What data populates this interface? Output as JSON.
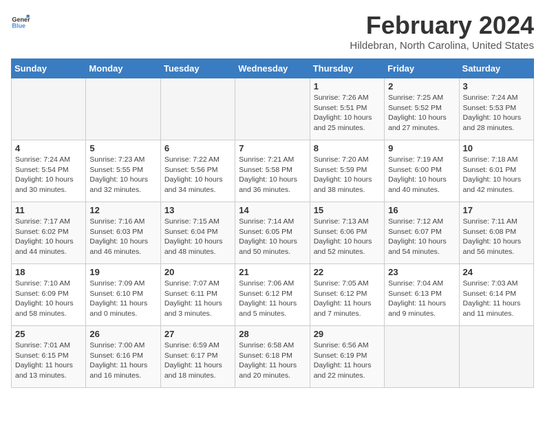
{
  "header": {
    "logo_general": "General",
    "logo_blue": "Blue",
    "title": "February 2024",
    "location": "Hildebran, North Carolina, United States"
  },
  "days_of_week": [
    "Sunday",
    "Monday",
    "Tuesday",
    "Wednesday",
    "Thursday",
    "Friday",
    "Saturday"
  ],
  "weeks": [
    [
      {
        "day": "",
        "info": ""
      },
      {
        "day": "",
        "info": ""
      },
      {
        "day": "",
        "info": ""
      },
      {
        "day": "",
        "info": ""
      },
      {
        "day": "1",
        "info": "Sunrise: 7:26 AM\nSunset: 5:51 PM\nDaylight: 10 hours\nand 25 minutes."
      },
      {
        "day": "2",
        "info": "Sunrise: 7:25 AM\nSunset: 5:52 PM\nDaylight: 10 hours\nand 27 minutes."
      },
      {
        "day": "3",
        "info": "Sunrise: 7:24 AM\nSunset: 5:53 PM\nDaylight: 10 hours\nand 28 minutes."
      }
    ],
    [
      {
        "day": "4",
        "info": "Sunrise: 7:24 AM\nSunset: 5:54 PM\nDaylight: 10 hours\nand 30 minutes."
      },
      {
        "day": "5",
        "info": "Sunrise: 7:23 AM\nSunset: 5:55 PM\nDaylight: 10 hours\nand 32 minutes."
      },
      {
        "day": "6",
        "info": "Sunrise: 7:22 AM\nSunset: 5:56 PM\nDaylight: 10 hours\nand 34 minutes."
      },
      {
        "day": "7",
        "info": "Sunrise: 7:21 AM\nSunset: 5:58 PM\nDaylight: 10 hours\nand 36 minutes."
      },
      {
        "day": "8",
        "info": "Sunrise: 7:20 AM\nSunset: 5:59 PM\nDaylight: 10 hours\nand 38 minutes."
      },
      {
        "day": "9",
        "info": "Sunrise: 7:19 AM\nSunset: 6:00 PM\nDaylight: 10 hours\nand 40 minutes."
      },
      {
        "day": "10",
        "info": "Sunrise: 7:18 AM\nSunset: 6:01 PM\nDaylight: 10 hours\nand 42 minutes."
      }
    ],
    [
      {
        "day": "11",
        "info": "Sunrise: 7:17 AM\nSunset: 6:02 PM\nDaylight: 10 hours\nand 44 minutes."
      },
      {
        "day": "12",
        "info": "Sunrise: 7:16 AM\nSunset: 6:03 PM\nDaylight: 10 hours\nand 46 minutes."
      },
      {
        "day": "13",
        "info": "Sunrise: 7:15 AM\nSunset: 6:04 PM\nDaylight: 10 hours\nand 48 minutes."
      },
      {
        "day": "14",
        "info": "Sunrise: 7:14 AM\nSunset: 6:05 PM\nDaylight: 10 hours\nand 50 minutes."
      },
      {
        "day": "15",
        "info": "Sunrise: 7:13 AM\nSunset: 6:06 PM\nDaylight: 10 hours\nand 52 minutes."
      },
      {
        "day": "16",
        "info": "Sunrise: 7:12 AM\nSunset: 6:07 PM\nDaylight: 10 hours\nand 54 minutes."
      },
      {
        "day": "17",
        "info": "Sunrise: 7:11 AM\nSunset: 6:08 PM\nDaylight: 10 hours\nand 56 minutes."
      }
    ],
    [
      {
        "day": "18",
        "info": "Sunrise: 7:10 AM\nSunset: 6:09 PM\nDaylight: 10 hours\nand 58 minutes."
      },
      {
        "day": "19",
        "info": "Sunrise: 7:09 AM\nSunset: 6:10 PM\nDaylight: 11 hours\nand 0 minutes."
      },
      {
        "day": "20",
        "info": "Sunrise: 7:07 AM\nSunset: 6:11 PM\nDaylight: 11 hours\nand 3 minutes."
      },
      {
        "day": "21",
        "info": "Sunrise: 7:06 AM\nSunset: 6:12 PM\nDaylight: 11 hours\nand 5 minutes."
      },
      {
        "day": "22",
        "info": "Sunrise: 7:05 AM\nSunset: 6:12 PM\nDaylight: 11 hours\nand 7 minutes."
      },
      {
        "day": "23",
        "info": "Sunrise: 7:04 AM\nSunset: 6:13 PM\nDaylight: 11 hours\nand 9 minutes."
      },
      {
        "day": "24",
        "info": "Sunrise: 7:03 AM\nSunset: 6:14 PM\nDaylight: 11 hours\nand 11 minutes."
      }
    ],
    [
      {
        "day": "25",
        "info": "Sunrise: 7:01 AM\nSunset: 6:15 PM\nDaylight: 11 hours\nand 13 minutes."
      },
      {
        "day": "26",
        "info": "Sunrise: 7:00 AM\nSunset: 6:16 PM\nDaylight: 11 hours\nand 16 minutes."
      },
      {
        "day": "27",
        "info": "Sunrise: 6:59 AM\nSunset: 6:17 PM\nDaylight: 11 hours\nand 18 minutes."
      },
      {
        "day": "28",
        "info": "Sunrise: 6:58 AM\nSunset: 6:18 PM\nDaylight: 11 hours\nand 20 minutes."
      },
      {
        "day": "29",
        "info": "Sunrise: 6:56 AM\nSunset: 6:19 PM\nDaylight: 11 hours\nand 22 minutes."
      },
      {
        "day": "",
        "info": ""
      },
      {
        "day": "",
        "info": ""
      }
    ]
  ]
}
